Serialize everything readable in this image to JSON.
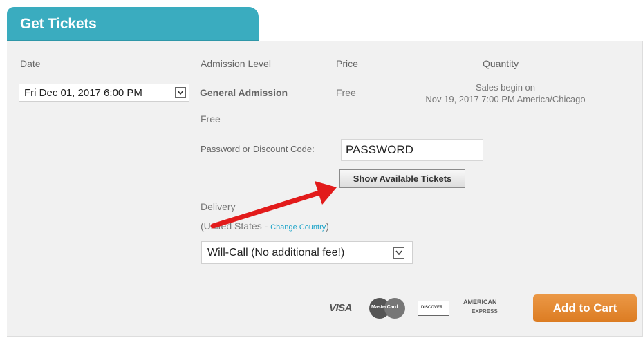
{
  "tab": {
    "title": "Get Tickets"
  },
  "table": {
    "headers": {
      "date": "Date",
      "admission": "Admission Level",
      "price": "Price",
      "quantity": "Quantity"
    }
  },
  "event": {
    "date_value": "Fri Dec 01, 2017 6:00 PM",
    "admission_level": "General Admission",
    "price": "Free",
    "sales_line1": "Sales begin on",
    "sales_line2": "Nov 19, 2017 7:00 PM America/Chicago",
    "admission_price_note": "Free"
  },
  "discount": {
    "label": "Password or Discount Code:",
    "value": "PASSWORD",
    "button_label": "Show Available Tickets"
  },
  "delivery": {
    "label": "Delivery",
    "country_prefix": "(United States - ",
    "change_country": "Change Country",
    "country_suffix": ")",
    "option": "Will-Call (No additional fee!)"
  },
  "payment": {
    "visa": "VISA",
    "mastercard": "MasterCard",
    "discover": "DISCOVER",
    "amex_line1": "AMERICAN",
    "amex_line2": "EXPRESS"
  },
  "cart": {
    "button_label": "Add to Cart"
  },
  "colors": {
    "tab": "#3aacbf",
    "cart_button": "#e08a2f",
    "arrow": "#e21b1b",
    "link": "#1aa3c8"
  }
}
